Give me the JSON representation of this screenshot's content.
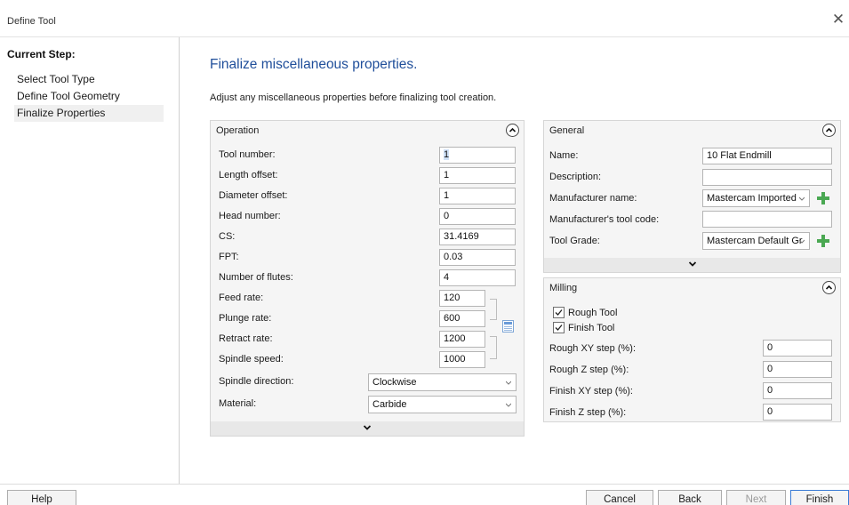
{
  "window": {
    "title": "Define Tool"
  },
  "sidebar": {
    "heading": "Current Step:",
    "steps": [
      {
        "label": "Select Tool Type"
      },
      {
        "label": "Define Tool Geometry"
      },
      {
        "label": "Finalize Properties"
      }
    ]
  },
  "main": {
    "title": "Finalize miscellaneous properties.",
    "description": "Adjust any miscellaneous properties before finalizing tool creation."
  },
  "operation": {
    "header": "Operation",
    "tool_number": {
      "label": "Tool number:",
      "value": "1"
    },
    "length_offset": {
      "label": "Length offset:",
      "value": "1"
    },
    "diameter_offset": {
      "label": "Diameter offset:",
      "value": "1"
    },
    "head_number": {
      "label": "Head number:",
      "value": "0"
    },
    "cs": {
      "label": "CS:",
      "value": "31.4169"
    },
    "fpt": {
      "label": "FPT:",
      "value": "0.03"
    },
    "number_of_flutes": {
      "label": "Number of flutes:",
      "value": "4"
    },
    "feed_rate": {
      "label": "Feed rate:",
      "value": "120"
    },
    "plunge_rate": {
      "label": "Plunge rate:",
      "value": "600"
    },
    "retract_rate": {
      "label": "Retract rate:",
      "value": "1200"
    },
    "spindle_speed": {
      "label": "Spindle speed:",
      "value": "1000"
    },
    "spindle_direction": {
      "label": "Spindle direction:",
      "value": "Clockwise"
    },
    "material": {
      "label": "Material:",
      "value": "Carbide"
    }
  },
  "general": {
    "header": "General",
    "name": {
      "label": "Name:",
      "value": "10 Flat Endmill"
    },
    "description": {
      "label": "Description:",
      "value": ""
    },
    "manufacturer_name": {
      "label": "Manufacturer name:",
      "value": "Mastercam Imported"
    },
    "manufacturer_code": {
      "label": "Manufacturer's tool code:",
      "value": ""
    },
    "tool_grade": {
      "label": "Tool Grade:",
      "value": "Mastercam Default Gr"
    }
  },
  "milling": {
    "header": "Milling",
    "rough_tool": {
      "label": "Rough Tool",
      "checked": true
    },
    "finish_tool": {
      "label": "Finish Tool",
      "checked": true
    },
    "rough_xy": {
      "label": "Rough XY step (%):",
      "value": "0"
    },
    "rough_z": {
      "label": "Rough Z step (%):",
      "value": "0"
    },
    "finish_xy": {
      "label": "Finish XY step (%):",
      "value": "0"
    },
    "finish_z": {
      "label": "Finish Z step (%):",
      "value": "0"
    }
  },
  "buttons": {
    "help": "Help",
    "cancel": "Cancel",
    "back": "Back",
    "next": "Next",
    "finish": "Finish"
  },
  "icons": {
    "close": "close-icon",
    "collapse": "chevron-up-circle-icon",
    "expand": "chevron-down-icon",
    "dropdown": "dropdown-arrow-icon",
    "add": "plus-icon",
    "link": "link-rates-icon",
    "check": "checkmark-icon"
  },
  "colors": {
    "title": "#1f4e9a",
    "panel_bg": "#f5f5f5",
    "plus": "#4aa852",
    "selection": "#cfe1f7"
  }
}
